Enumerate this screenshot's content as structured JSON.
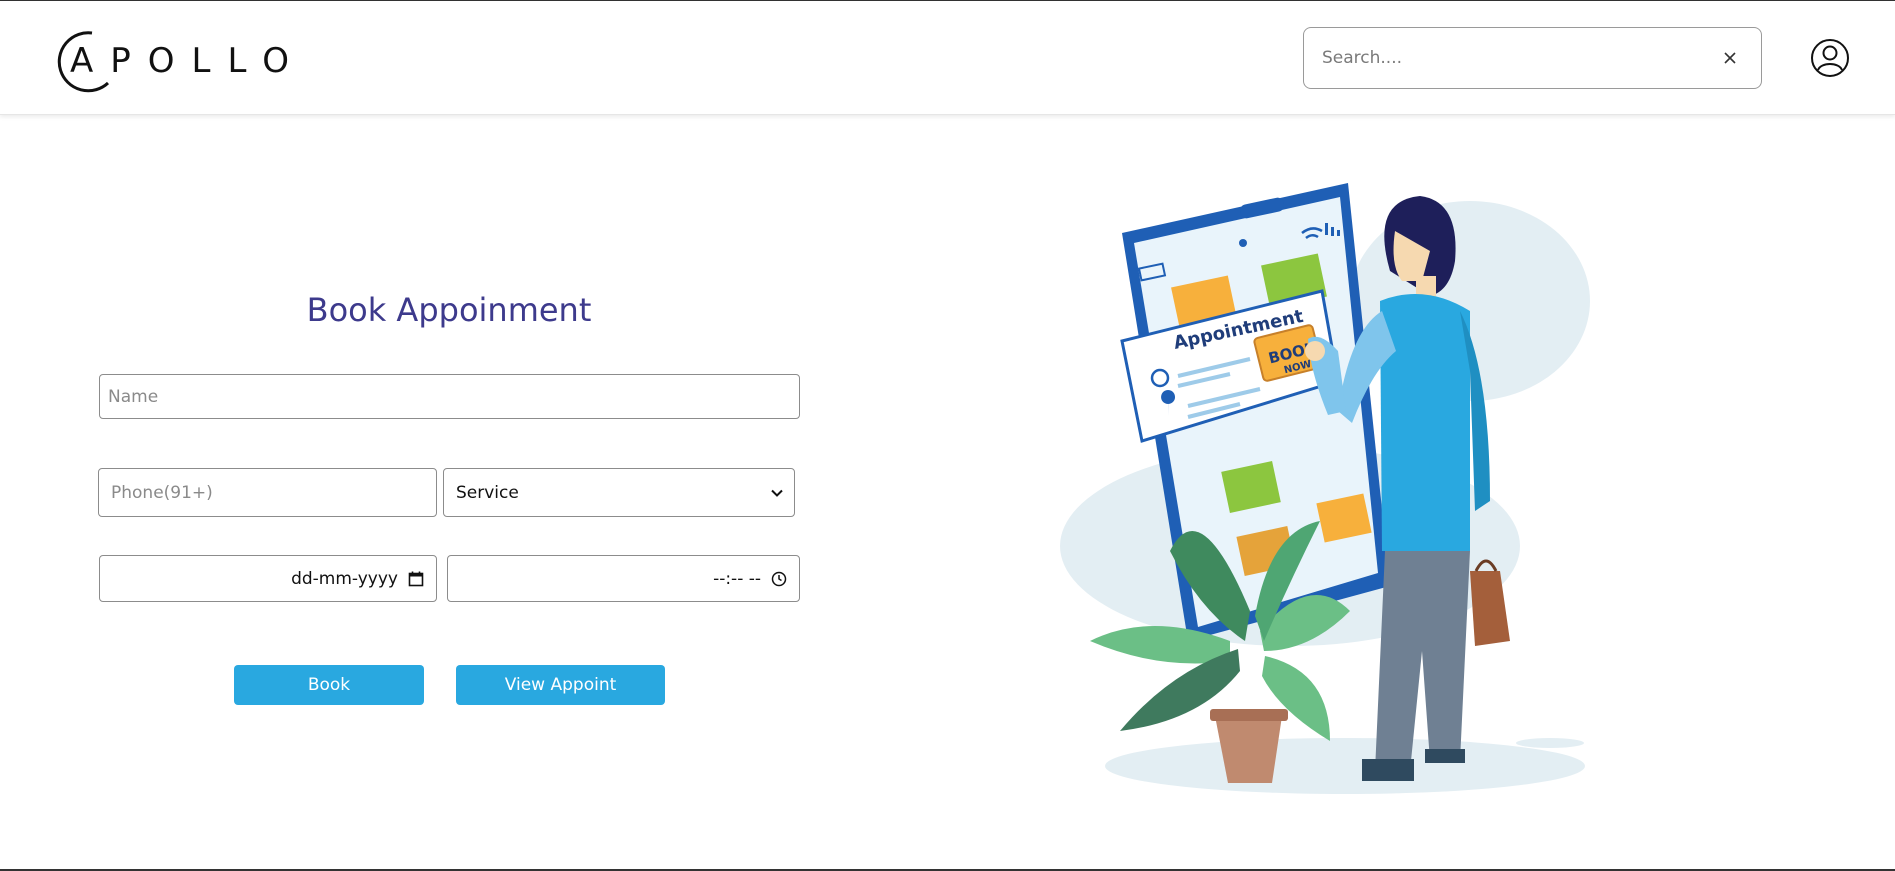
{
  "header": {
    "logo_text": "APOLLO",
    "search": {
      "placeholder": "Search....",
      "value": ""
    }
  },
  "form": {
    "title": "Book Appoinment",
    "name_placeholder": "Name",
    "phone_placeholder": "Phone(91+)",
    "service_selected": "Service",
    "date_placeholder": "dd-mm-yyyy",
    "time_placeholder": "--:-- --",
    "book_label": "Book",
    "view_label": "View Appoint"
  },
  "illustration": {
    "card_title": "Appointment",
    "book_button_line1": "BOOK",
    "book_button_line2": "NOW"
  },
  "colors": {
    "title": "#3d3a8c",
    "button": "#29a8e0",
    "phone_frame": "#1f5fb5"
  },
  "icons": [
    "user-circle-icon",
    "close-icon",
    "chevron-down-icon",
    "calendar-icon",
    "clock-icon"
  ]
}
